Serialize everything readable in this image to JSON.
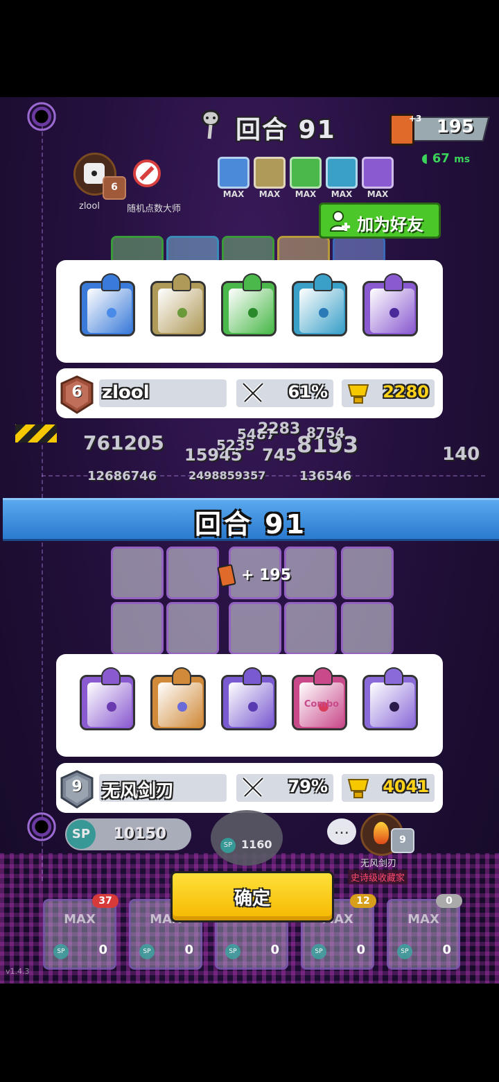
{
  "header": {
    "round_title": "回合 91",
    "cards": {
      "plus": "+3",
      "count": "195"
    },
    "ping": {
      "value": "67",
      "unit": "ms"
    }
  },
  "opponent_small": {
    "name": "zlool",
    "title": "随机点数大师",
    "rank": "6"
  },
  "mini_dice": [
    {
      "label": "MAX",
      "color": "#4a8ad8",
      "icon": "snowflake-die"
    },
    {
      "label": "MAX",
      "color": "#b09a5a",
      "icon": "shield-die"
    },
    {
      "label": "MAX",
      "color": "#4ab84a",
      "icon": "radar-die"
    },
    {
      "label": "MAX",
      "color": "#3aa0c8",
      "icon": "vortex-die"
    },
    {
      "label": "MAX",
      "color": "#8a5ad0",
      "icon": "orbit-die"
    }
  ],
  "add_friend": {
    "label": "加为好友"
  },
  "top_player": {
    "rank": "6",
    "name": "zlool",
    "crit": "61%",
    "trophies": "2280",
    "dice": [
      {
        "icon": "snowflake-die",
        "color": "#3a7ad8",
        "pip": "#4a8ae8"
      },
      {
        "icon": "shield-die",
        "color": "#b09a5a",
        "pip": "#6a9a3a"
      },
      {
        "icon": "radar-die",
        "color": "#4ab84a",
        "pip": "#2a8a2a"
      },
      {
        "icon": "vortex-die",
        "color": "#3aa0c8",
        "pip": "#2a7ab8"
      },
      {
        "icon": "orbit-die",
        "color": "#8a5ad0",
        "pip": "#4a2a9a"
      }
    ]
  },
  "background_numbers": [
    "761205",
    "15945",
    "8193",
    "140",
    "12686746",
    "2498859357",
    "136546",
    "5487",
    "2283",
    "8754",
    "5235",
    "745"
  ],
  "round_banner": {
    "text": "回合  91"
  },
  "reward": {
    "text": "+ 195"
  },
  "bottom_player": {
    "rank": "9",
    "name": "无风剑刃",
    "crit": "79%",
    "trophies": "4041",
    "dice": [
      {
        "icon": "orbit-die",
        "color": "#8a5ad0",
        "pip": "#6a3ab0"
      },
      {
        "icon": "infinity-die",
        "color": "#d08a3a",
        "pip": "#6a6ad8"
      },
      {
        "icon": "moon-die",
        "color": "#7a5ad0",
        "pip": "#5a3ab0"
      },
      {
        "icon": "combo-die",
        "color": "#c84a8a",
        "pip": "#d83a5a",
        "text": "Combo"
      },
      {
        "icon": "crack-die",
        "color": "#8a6ad8",
        "pip": "#2a1a4a"
      }
    ]
  },
  "bottom_bar": {
    "sp_value": "10150",
    "spawn_cost": "1160",
    "sp_label": "SP",
    "me_name": "无风剑刃",
    "me_title": "史诗级收藏家",
    "me_rank": "9"
  },
  "confirm": {
    "label": "确定"
  },
  "deck": [
    {
      "max": "MAX",
      "count": "0",
      "level": "37",
      "level_color": "#d83a3a"
    },
    {
      "max": "MAX",
      "count": "0",
      "level": "",
      "level_color": ""
    },
    {
      "max": "",
      "count": "0",
      "level": "",
      "level_color": ""
    },
    {
      "max": "MAX",
      "count": "0",
      "level": "12",
      "level_color": "#d8a01a"
    },
    {
      "max": "MAX",
      "count": "0",
      "level": "0",
      "level_color": "#aaaaaa"
    }
  ],
  "version": "v1.4.3"
}
